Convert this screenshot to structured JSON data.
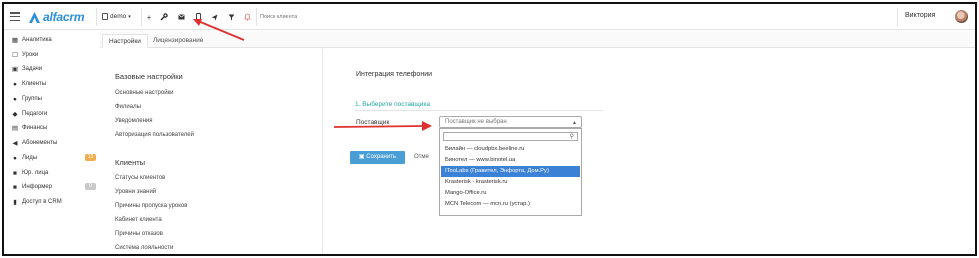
{
  "app": {
    "logo_text": "alfacrm",
    "branch_selector": "demo",
    "search_placeholder": "Поиск клиента",
    "user_name": "Виктория"
  },
  "toolbar": {
    "icons": [
      "plus-icon",
      "wrench-icon",
      "envelope-icon",
      "phone-icon",
      "send-icon",
      "filter-icon",
      "bell-icon"
    ]
  },
  "sidebar": {
    "items": [
      {
        "label": "Аналитика",
        "icon": "chart-icon"
      },
      {
        "label": "Уроки",
        "icon": "calendar-icon"
      },
      {
        "label": "Задачи",
        "icon": "tasks-icon"
      },
      {
        "label": "Клиенты",
        "icon": "user-icon"
      },
      {
        "label": "Группы",
        "icon": "users-icon"
      },
      {
        "label": "Педагоги",
        "icon": "graduation-icon"
      },
      {
        "label": "Финансы",
        "icon": "money-icon"
      },
      {
        "label": "Абонементы",
        "icon": "tag-icon"
      },
      {
        "label": "Лиды",
        "icon": "lead-icon",
        "badge": "13",
        "badge_color": "#f0ad4e"
      },
      {
        "label": "Юр. лица",
        "icon": "building-icon"
      },
      {
        "label": "Информер",
        "icon": "inbox-icon",
        "badge": "0",
        "badge_color": "#c8c8c8"
      },
      {
        "label": "Доступ в CRM",
        "icon": "lock-icon"
      }
    ]
  },
  "tabs": [
    {
      "label": "Настройки",
      "active": true
    },
    {
      "label": "Лицензирование",
      "active": false
    }
  ],
  "settings": {
    "base_title": "Базовые настройки",
    "base_links": [
      "Основные настройки",
      "Филиалы",
      "Уведомления",
      "Авторизация пользователей"
    ],
    "clients_title": "Клиенты",
    "clients_links": [
      "Статусы клиентов",
      "Уровни знаний",
      "Причины пропуска уроков",
      "Кабинет клиента",
      "Причины отказов",
      "Система лояльности"
    ]
  },
  "telephony": {
    "title": "Интеграция телефонии",
    "step1": "1. Выберите поставщика",
    "provider_label": "Поставщик",
    "select_value": "Поставщик не выбран",
    "options": [
      "Билайн — cloudpbx.beeline.ru",
      "Бинотел — www.binotel.ua",
      "ITooLabs (Гравител, Энфорта, Дом.Ру)",
      "Krasterisk - krasterisk.ru",
      "Mango-Office.ru",
      "MCN Telecom — mcn.ru (устар.)"
    ],
    "highlighted_option": 2,
    "save_label": "Сохранить",
    "cancel_label": "Отме"
  },
  "colors": {
    "brand": "#2a8fd8",
    "accent_teal": "#23a3a6",
    "highlight": "#3b82d6",
    "save_button": "#4a9ed6",
    "annotation_arrow": "#e03030"
  }
}
